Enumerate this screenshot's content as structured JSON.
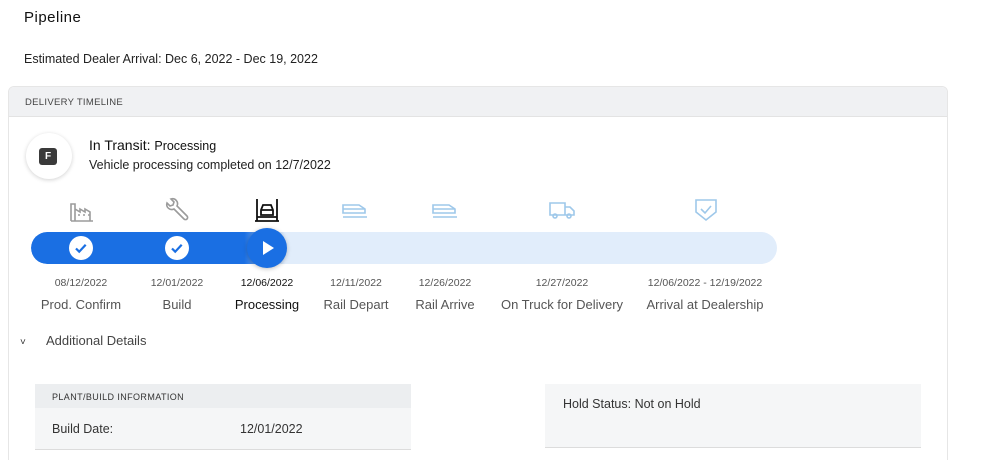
{
  "page": {
    "title": "Pipeline",
    "estimated_arrival": "Estimated Dealer Arrival: Dec 6, 2022 - Dec 19, 2022"
  },
  "timeline": {
    "header": "DELIVERY TIMELINE",
    "badge_letter": "F",
    "status_label": "In Transit:",
    "status_value": "Processing",
    "status_detail": "Vehicle processing completed on 12/7/2022",
    "progress": 0.34,
    "colors": {
      "accent": "#1a6fe3",
      "track": "#e1edfb",
      "inactive_icon": "#9ec8ea",
      "done_icon": "#9b9b9b"
    },
    "steps": [
      {
        "date": "08/12/2022",
        "name": "Prod. Confirm",
        "icon": "factory-icon",
        "state": "done"
      },
      {
        "date": "12/01/2022",
        "name": "Build",
        "icon": "wrench-icon",
        "state": "done"
      },
      {
        "date": "12/06/2022",
        "name": "Processing",
        "icon": "vehicle-lift-icon",
        "state": "current"
      },
      {
        "date": "12/11/2022",
        "name": "Rail Depart",
        "icon": "train-icon",
        "state": "pending"
      },
      {
        "date": "12/26/2022",
        "name": "Rail Arrive",
        "icon": "train-icon",
        "state": "pending"
      },
      {
        "date": "12/27/2022",
        "name": "On Truck for Delivery",
        "icon": "truck-icon",
        "state": "pending"
      },
      {
        "date": "12/06/2022 - 12/19/2022",
        "name": "Arrival at Dealership",
        "icon": "shield-check-icon",
        "state": "pending"
      }
    ]
  },
  "additional": {
    "label": "Additional Details",
    "plant": {
      "header": "PLANT/BUILD INFORMATION",
      "build_date_label": "Build Date:",
      "build_date_value": "12/01/2022"
    },
    "hold_status": "Hold Status: Not on Hold"
  }
}
